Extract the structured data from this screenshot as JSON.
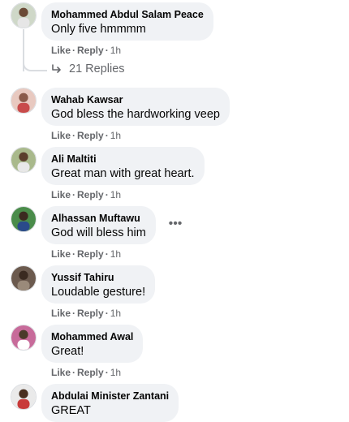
{
  "comments": [
    {
      "author": "Mohammed Abdul Salam Peace",
      "text": "Only five hmmmm",
      "like": "Like",
      "reply": "Reply",
      "time": "1h"
    },
    {
      "author": "Wahab Kawsar",
      "text": "God bless the hardworking veep",
      "like": "Like",
      "reply": "Reply",
      "time": "1h"
    },
    {
      "author": "Ali Maltiti",
      "text": "Great man with great heart.",
      "like": "Like",
      "reply": "Reply",
      "time": "1h"
    },
    {
      "author": "Alhassan Muftawu",
      "text": "God will bless him",
      "like": "Like",
      "reply": "Reply",
      "time": "1h"
    },
    {
      "author": "Yussif Tahiru",
      "text": "Loudable gesture!",
      "like": "Like",
      "reply": "Reply",
      "time": "1h"
    },
    {
      "author": "Mohammed Awal",
      "text": "Great!",
      "like": "Like",
      "reply": "Reply",
      "time": "1h"
    },
    {
      "author": "Abdulai Minister Zantani",
      "text": "GREAT"
    }
  ],
  "replies_link": "21 Replies",
  "more_icon": "•••",
  "separator": "·",
  "icons": {
    "reply_arrow": "reply-arrow-icon",
    "more": "more-options-icon"
  },
  "colors": {
    "bubble": "#f0f2f5",
    "meta_text": "#65676b",
    "primary_text": "#050505"
  }
}
